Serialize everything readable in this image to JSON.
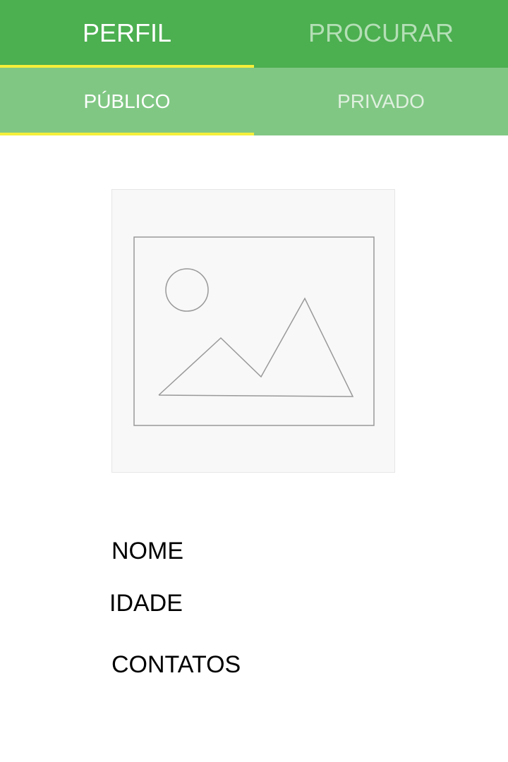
{
  "top_tabs": {
    "profile_label": "PERFIL",
    "search_label": "PROCURAR",
    "active": "PERFIL"
  },
  "sub_tabs": {
    "public_label": "PÚBLICO",
    "private_label": "PRIVADO",
    "active": "PÚBLICO"
  },
  "colors": {
    "primary": "#4caf50",
    "primary_light": "#81c784",
    "indicator": "#f5ef3a"
  },
  "profile": {
    "image_icon": "image-placeholder-icon",
    "name_label": "NOME",
    "age_label": "IDADE",
    "contacts_label": "CONTATOS"
  }
}
